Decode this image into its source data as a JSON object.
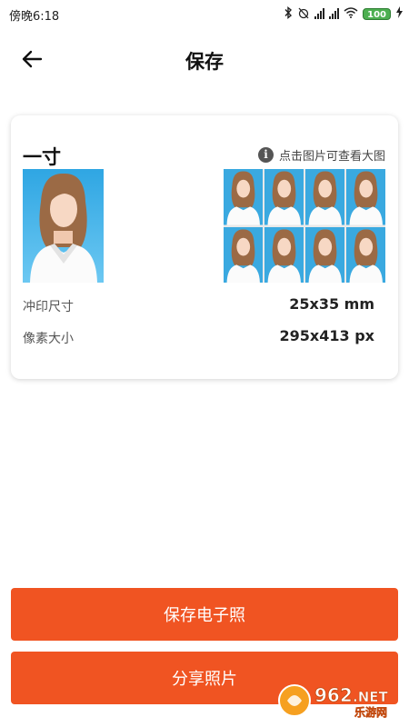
{
  "status_bar": {
    "time": "傍晚6:18",
    "battery": "100"
  },
  "header": {
    "title": "保存",
    "back_icon": "arrow-left-icon"
  },
  "card": {
    "size_name": "一寸",
    "hint": "点击图片可查看大图",
    "info_icon": "info-icon",
    "rows": [
      {
        "label": "冲印尺寸",
        "value": "25x35 mm"
      },
      {
        "label": "像素大小",
        "value": "295x413 px"
      }
    ]
  },
  "actions": {
    "save_label": "保存电子照",
    "share_label": "分享照片"
  },
  "watermark": {
    "number": "962",
    "suffix": ".NET",
    "subtitle": "乐游网"
  },
  "colors": {
    "accent": "#f05422",
    "photo_background": "#3aa9e0"
  }
}
